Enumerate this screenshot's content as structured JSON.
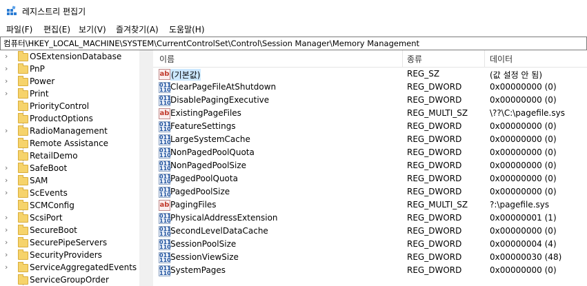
{
  "window": {
    "title": "레지스트리 편집기"
  },
  "menu": [
    "파일(F)",
    "편집(E)",
    "보기(V)",
    "즐겨찾기(A)",
    "도움말(H)"
  ],
  "address": "컴퓨터\\HKEY_LOCAL_MACHINE\\SYSTEM\\CurrentControlSet\\Control\\Session Manager\\Memory Management",
  "tree": [
    {
      "label": "OSExtensionDatabase",
      "expandable": true
    },
    {
      "label": "PnP",
      "expandable": true
    },
    {
      "label": "Power",
      "expandable": true
    },
    {
      "label": "Print",
      "expandable": true
    },
    {
      "label": "PriorityControl",
      "expandable": false
    },
    {
      "label": "ProductOptions",
      "expandable": false
    },
    {
      "label": "RadioManagement",
      "expandable": true
    },
    {
      "label": "Remote Assistance",
      "expandable": false
    },
    {
      "label": "RetailDemo",
      "expandable": false
    },
    {
      "label": "SafeBoot",
      "expandable": true
    },
    {
      "label": "SAM",
      "expandable": true
    },
    {
      "label": "ScEvents",
      "expandable": true
    },
    {
      "label": "SCMConfig",
      "expandable": false
    },
    {
      "label": "ScsiPort",
      "expandable": true
    },
    {
      "label": "SecureBoot",
      "expandable": true
    },
    {
      "label": "SecurePipeServers",
      "expandable": true
    },
    {
      "label": "SecurityProviders",
      "expandable": true
    },
    {
      "label": "ServiceAggregatedEvents",
      "expandable": true
    },
    {
      "label": "ServiceGroupOrder",
      "expandable": false
    }
  ],
  "columns": {
    "name": "이름",
    "type": "종류",
    "data": "데이터"
  },
  "values": [
    {
      "name": "(기본값)",
      "type": "REG_SZ",
      "data": "(값 설정 안 됨)",
      "icon": "sz"
    },
    {
      "name": "ClearPageFileAtShutdown",
      "type": "REG_DWORD",
      "data": "0x00000000 (0)",
      "icon": "bin"
    },
    {
      "name": "DisablePagingExecutive",
      "type": "REG_DWORD",
      "data": "0x00000000 (0)",
      "icon": "bin"
    },
    {
      "name": "ExistingPageFiles",
      "type": "REG_MULTI_SZ",
      "data": "\\??\\C:\\pagefile.sys",
      "icon": "sz"
    },
    {
      "name": "FeatureSettings",
      "type": "REG_DWORD",
      "data": "0x00000000 (0)",
      "icon": "bin"
    },
    {
      "name": "LargeSystemCache",
      "type": "REG_DWORD",
      "data": "0x00000000 (0)",
      "icon": "bin"
    },
    {
      "name": "NonPagedPoolQuota",
      "type": "REG_DWORD",
      "data": "0x00000000 (0)",
      "icon": "bin"
    },
    {
      "name": "NonPagedPoolSize",
      "type": "REG_DWORD",
      "data": "0x00000000 (0)",
      "icon": "bin"
    },
    {
      "name": "PagedPoolQuota",
      "type": "REG_DWORD",
      "data": "0x00000000 (0)",
      "icon": "bin"
    },
    {
      "name": "PagedPoolSize",
      "type": "REG_DWORD",
      "data": "0x00000000 (0)",
      "icon": "bin"
    },
    {
      "name": "PagingFiles",
      "type": "REG_MULTI_SZ",
      "data": "?:\\pagefile.sys",
      "icon": "sz"
    },
    {
      "name": "PhysicalAddressExtension",
      "type": "REG_DWORD",
      "data": "0x00000001 (1)",
      "icon": "bin"
    },
    {
      "name": "SecondLevelDataCache",
      "type": "REG_DWORD",
      "data": "0x00000000 (0)",
      "icon": "bin"
    },
    {
      "name": "SessionPoolSize",
      "type": "REG_DWORD",
      "data": "0x00000004 (4)",
      "icon": "bin"
    },
    {
      "name": "SessionViewSize",
      "type": "REG_DWORD",
      "data": "0x00000030 (48)",
      "icon": "bin"
    },
    {
      "name": "SystemPages",
      "type": "REG_DWORD",
      "data": "0x00000000 (0)",
      "icon": "bin"
    }
  ],
  "icons": {
    "app": "registry-editor-icon",
    "sz": "string-value-icon",
    "bin": "binary-value-icon",
    "folder": "folder-icon",
    "expand": "chevron-right-icon"
  }
}
